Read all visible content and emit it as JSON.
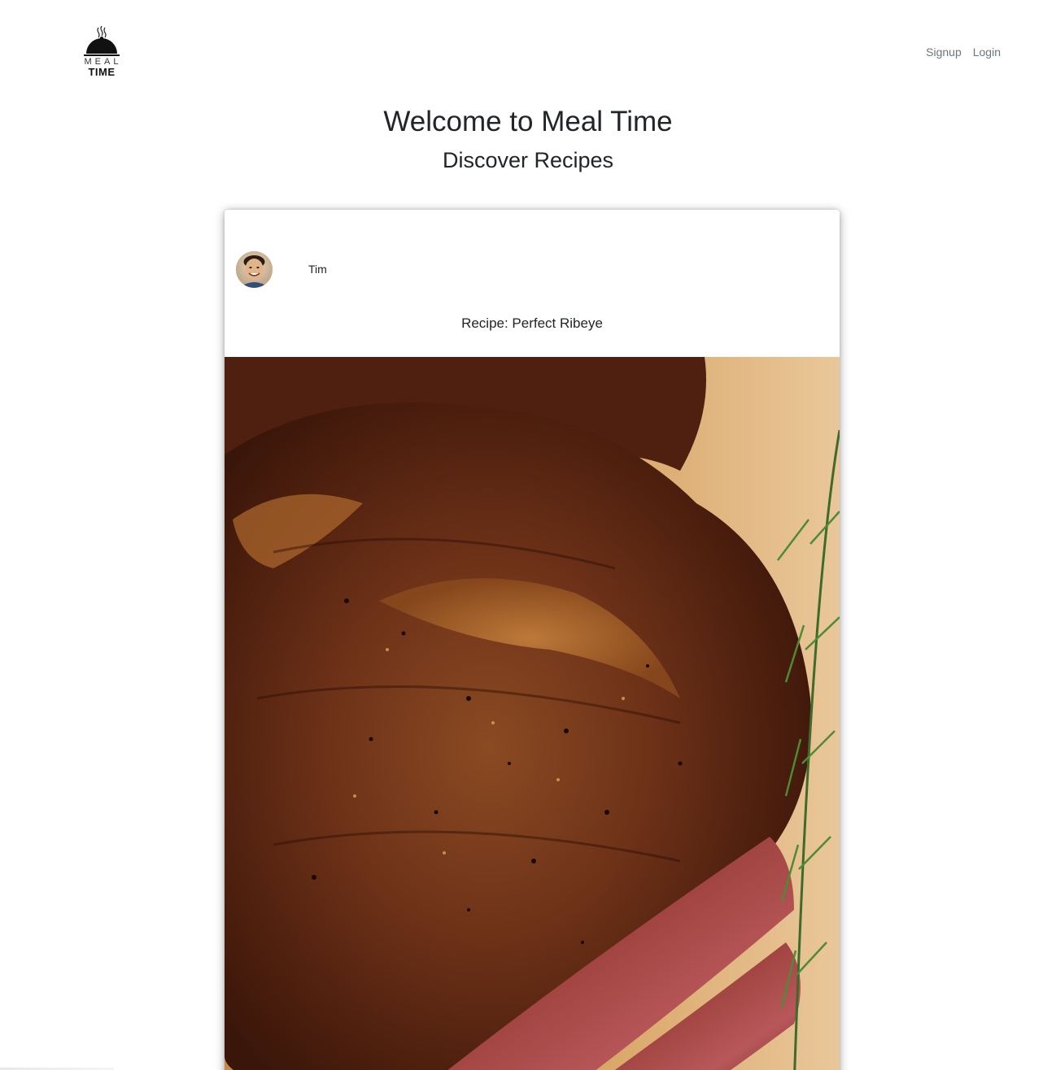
{
  "brand": {
    "line1": "MEAL",
    "line2": "TIME",
    "icon": "cloche-icon"
  },
  "nav": {
    "signup": "Signup",
    "login": "Login"
  },
  "hero": {
    "title": "Welcome to Meal Time",
    "subtitle": "Discover Recipes"
  },
  "card": {
    "author": "Tim",
    "title": "Recipe: Perfect Ribeye"
  },
  "colors": {
    "nav_link": "#6c757d",
    "text": "#212529"
  }
}
